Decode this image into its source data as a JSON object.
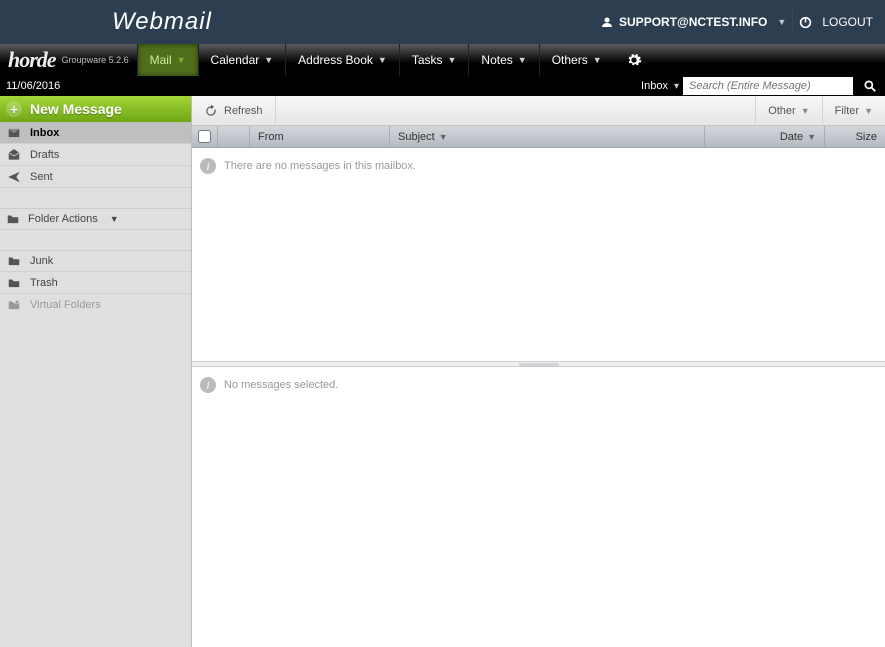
{
  "topbar": {
    "brand": "Webmail",
    "user": "SUPPORT@NCTEST.INFO",
    "logout": "LOGOUT"
  },
  "horde": {
    "name": "horde",
    "sub": "Groupware 5.2.6"
  },
  "menu": {
    "mail": "Mail",
    "calendar": "Calendar",
    "address_book": "Address Book",
    "tasks": "Tasks",
    "notes": "Notes",
    "others": "Others"
  },
  "searchbar": {
    "date": "11/06/2016",
    "inbox_label": "Inbox",
    "placeholder": "Search (Entire Message)"
  },
  "sidebar": {
    "new_message": "New Message",
    "inbox": "Inbox",
    "drafts": "Drafts",
    "sent": "Sent",
    "folder_actions": "Folder Actions",
    "junk": "Junk",
    "trash": "Trash",
    "virtual": "Virtual Folders"
  },
  "toolbar": {
    "refresh": "Refresh",
    "other": "Other",
    "filter": "Filter"
  },
  "columns": {
    "from": "From",
    "subject": "Subject",
    "date": "Date",
    "size": "Size"
  },
  "list": {
    "empty": "There are no messages in this mailbox."
  },
  "preview": {
    "empty": "No messages selected."
  }
}
